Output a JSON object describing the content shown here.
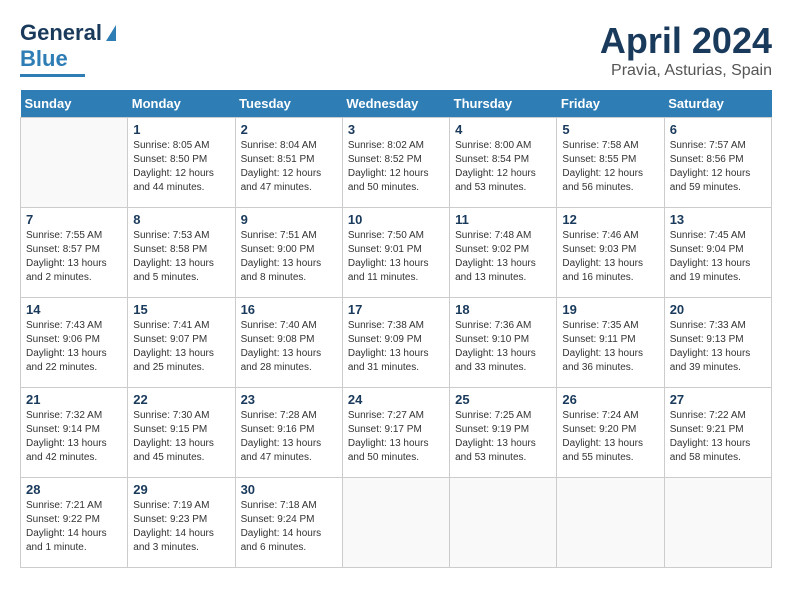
{
  "header": {
    "logo_general": "General",
    "logo_blue": "Blue",
    "month": "April 2024",
    "location": "Pravia, Asturias, Spain"
  },
  "weekdays": [
    "Sunday",
    "Monday",
    "Tuesday",
    "Wednesday",
    "Thursday",
    "Friday",
    "Saturday"
  ],
  "weeks": [
    [
      {
        "day": "",
        "info": ""
      },
      {
        "day": "1",
        "info": "Sunrise: 8:05 AM\nSunset: 8:50 PM\nDaylight: 12 hours\nand 44 minutes."
      },
      {
        "day": "2",
        "info": "Sunrise: 8:04 AM\nSunset: 8:51 PM\nDaylight: 12 hours\nand 47 minutes."
      },
      {
        "day": "3",
        "info": "Sunrise: 8:02 AM\nSunset: 8:52 PM\nDaylight: 12 hours\nand 50 minutes."
      },
      {
        "day": "4",
        "info": "Sunrise: 8:00 AM\nSunset: 8:54 PM\nDaylight: 12 hours\nand 53 minutes."
      },
      {
        "day": "5",
        "info": "Sunrise: 7:58 AM\nSunset: 8:55 PM\nDaylight: 12 hours\nand 56 minutes."
      },
      {
        "day": "6",
        "info": "Sunrise: 7:57 AM\nSunset: 8:56 PM\nDaylight: 12 hours\nand 59 minutes."
      }
    ],
    [
      {
        "day": "7",
        "info": "Sunrise: 7:55 AM\nSunset: 8:57 PM\nDaylight: 13 hours\nand 2 minutes."
      },
      {
        "day": "8",
        "info": "Sunrise: 7:53 AM\nSunset: 8:58 PM\nDaylight: 13 hours\nand 5 minutes."
      },
      {
        "day": "9",
        "info": "Sunrise: 7:51 AM\nSunset: 9:00 PM\nDaylight: 13 hours\nand 8 minutes."
      },
      {
        "day": "10",
        "info": "Sunrise: 7:50 AM\nSunset: 9:01 PM\nDaylight: 13 hours\nand 11 minutes."
      },
      {
        "day": "11",
        "info": "Sunrise: 7:48 AM\nSunset: 9:02 PM\nDaylight: 13 hours\nand 13 minutes."
      },
      {
        "day": "12",
        "info": "Sunrise: 7:46 AM\nSunset: 9:03 PM\nDaylight: 13 hours\nand 16 minutes."
      },
      {
        "day": "13",
        "info": "Sunrise: 7:45 AM\nSunset: 9:04 PM\nDaylight: 13 hours\nand 19 minutes."
      }
    ],
    [
      {
        "day": "14",
        "info": "Sunrise: 7:43 AM\nSunset: 9:06 PM\nDaylight: 13 hours\nand 22 minutes."
      },
      {
        "day": "15",
        "info": "Sunrise: 7:41 AM\nSunset: 9:07 PM\nDaylight: 13 hours\nand 25 minutes."
      },
      {
        "day": "16",
        "info": "Sunrise: 7:40 AM\nSunset: 9:08 PM\nDaylight: 13 hours\nand 28 minutes."
      },
      {
        "day": "17",
        "info": "Sunrise: 7:38 AM\nSunset: 9:09 PM\nDaylight: 13 hours\nand 31 minutes."
      },
      {
        "day": "18",
        "info": "Sunrise: 7:36 AM\nSunset: 9:10 PM\nDaylight: 13 hours\nand 33 minutes."
      },
      {
        "day": "19",
        "info": "Sunrise: 7:35 AM\nSunset: 9:11 PM\nDaylight: 13 hours\nand 36 minutes."
      },
      {
        "day": "20",
        "info": "Sunrise: 7:33 AM\nSunset: 9:13 PM\nDaylight: 13 hours\nand 39 minutes."
      }
    ],
    [
      {
        "day": "21",
        "info": "Sunrise: 7:32 AM\nSunset: 9:14 PM\nDaylight: 13 hours\nand 42 minutes."
      },
      {
        "day": "22",
        "info": "Sunrise: 7:30 AM\nSunset: 9:15 PM\nDaylight: 13 hours\nand 45 minutes."
      },
      {
        "day": "23",
        "info": "Sunrise: 7:28 AM\nSunset: 9:16 PM\nDaylight: 13 hours\nand 47 minutes."
      },
      {
        "day": "24",
        "info": "Sunrise: 7:27 AM\nSunset: 9:17 PM\nDaylight: 13 hours\nand 50 minutes."
      },
      {
        "day": "25",
        "info": "Sunrise: 7:25 AM\nSunset: 9:19 PM\nDaylight: 13 hours\nand 53 minutes."
      },
      {
        "day": "26",
        "info": "Sunrise: 7:24 AM\nSunset: 9:20 PM\nDaylight: 13 hours\nand 55 minutes."
      },
      {
        "day": "27",
        "info": "Sunrise: 7:22 AM\nSunset: 9:21 PM\nDaylight: 13 hours\nand 58 minutes."
      }
    ],
    [
      {
        "day": "28",
        "info": "Sunrise: 7:21 AM\nSunset: 9:22 PM\nDaylight: 14 hours\nand 1 minute."
      },
      {
        "day": "29",
        "info": "Sunrise: 7:19 AM\nSunset: 9:23 PM\nDaylight: 14 hours\nand 3 minutes."
      },
      {
        "day": "30",
        "info": "Sunrise: 7:18 AM\nSunset: 9:24 PM\nDaylight: 14 hours\nand 6 minutes."
      },
      {
        "day": "",
        "info": ""
      },
      {
        "day": "",
        "info": ""
      },
      {
        "day": "",
        "info": ""
      },
      {
        "day": "",
        "info": ""
      }
    ]
  ]
}
